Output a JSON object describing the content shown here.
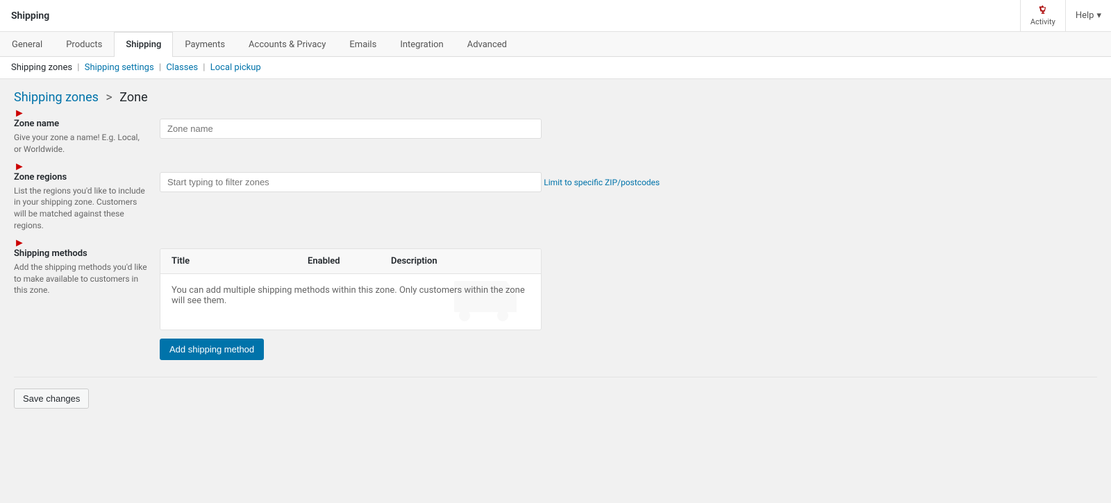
{
  "topbar": {
    "title": "Shipping",
    "activity_label": "Activity",
    "help_label": "Help"
  },
  "nav": {
    "tabs": [
      {
        "id": "general",
        "label": "General",
        "active": false
      },
      {
        "id": "products",
        "label": "Products",
        "active": false
      },
      {
        "id": "shipping",
        "label": "Shipping",
        "active": true
      },
      {
        "id": "payments",
        "label": "Payments",
        "active": false
      },
      {
        "id": "accounts_privacy",
        "label": "Accounts & Privacy",
        "active": false
      },
      {
        "id": "emails",
        "label": "Emails",
        "active": false
      },
      {
        "id": "integration",
        "label": "Integration",
        "active": false
      },
      {
        "id": "advanced",
        "label": "Advanced",
        "active": false
      }
    ]
  },
  "subnav": {
    "items": [
      {
        "id": "shipping_zones",
        "label": "Shipping zones",
        "active": true
      },
      {
        "id": "shipping_settings",
        "label": "Shipping settings",
        "active": false
      },
      {
        "id": "classes",
        "label": "Classes",
        "active": false
      },
      {
        "id": "local_pickup",
        "label": "Local pickup",
        "active": false
      }
    ]
  },
  "breadcrumb": {
    "parent_label": "Shipping zones",
    "separator": ">",
    "current_label": "Zone"
  },
  "zone_name_field": {
    "label": "Zone name",
    "description": "Give your zone a name! E.g. Local, or Worldwide.",
    "placeholder": "Zone name",
    "value": ""
  },
  "zone_regions_field": {
    "label": "Zone regions",
    "description": "List the regions you'd like to include in your shipping zone. Customers will be matched against these regions.",
    "placeholder": "Start typing to filter zones",
    "value": "",
    "limit_link": "Limit to specific ZIP/postcodes"
  },
  "shipping_methods": {
    "label": "Shipping methods",
    "description": "Add the shipping methods you'd like to make available to customers in this zone.",
    "table": {
      "col_title": "Title",
      "col_enabled": "Enabled",
      "col_description": "Description",
      "empty_message": "You can add multiple shipping methods within this zone. Only customers within the zone will see them."
    },
    "add_button": "Add shipping method"
  },
  "save_button": "Save changes"
}
